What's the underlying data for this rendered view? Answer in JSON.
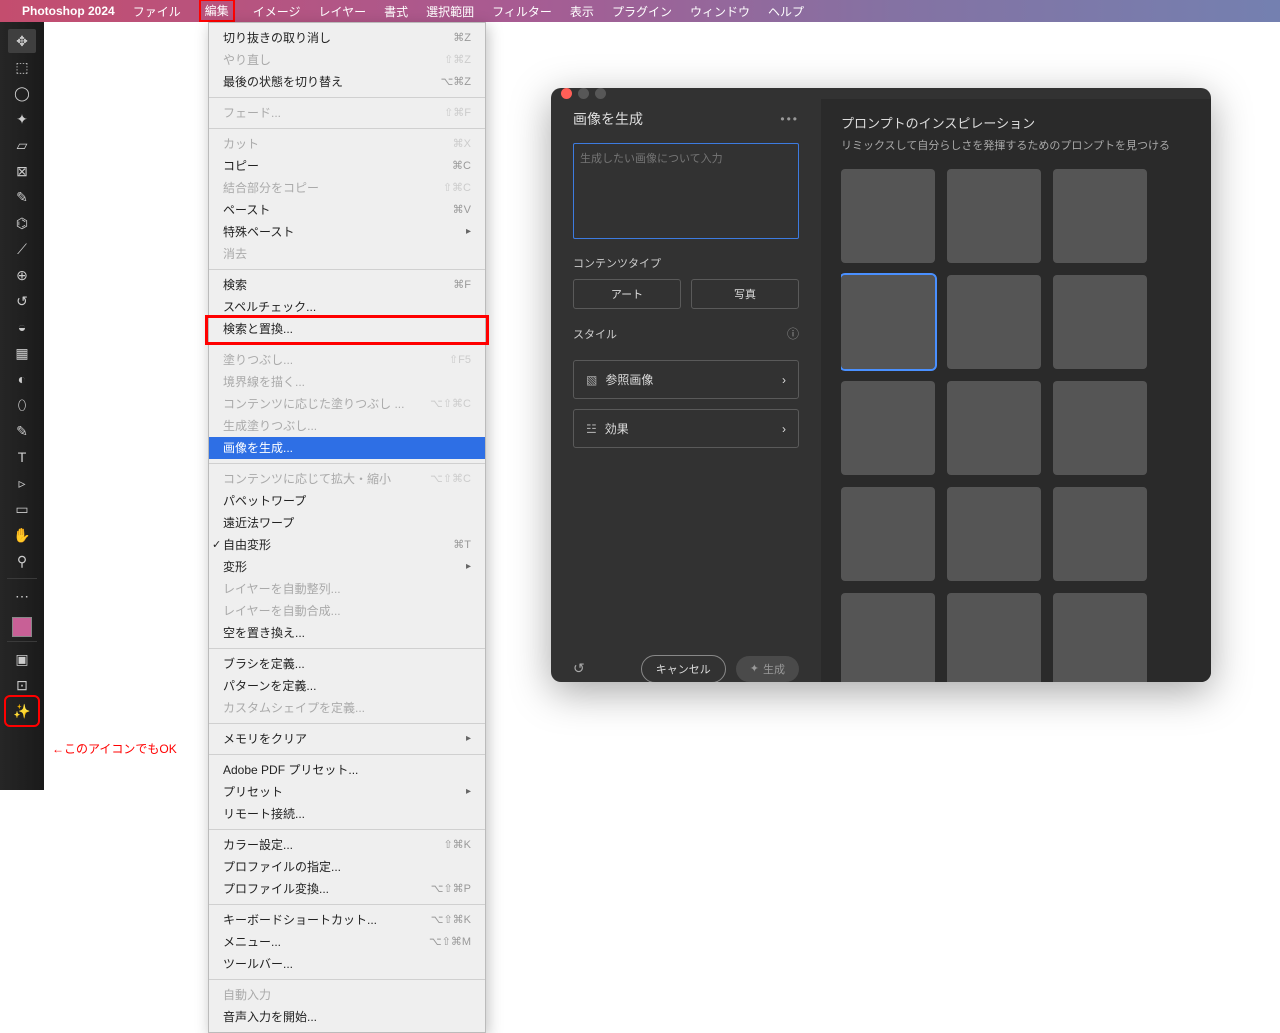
{
  "menubar": {
    "app": "Photoshop 2024",
    "items": [
      "ファイル",
      "編集",
      "イメージ",
      "レイヤー",
      "書式",
      "選択範囲",
      "フィルター",
      "表示",
      "プラグイン",
      "ウィンドウ",
      "ヘルプ"
    ]
  },
  "dropdown": {
    "groups": [
      [
        {
          "label": "切り抜きの取り消し",
          "sc": "⌘Z"
        },
        {
          "label": "やり直し",
          "sc": "⇧⌘Z",
          "disabled": true
        },
        {
          "label": "最後の状態を切り替え",
          "sc": "⌥⌘Z"
        }
      ],
      [
        {
          "label": "フェード...",
          "sc": "⇧⌘F",
          "disabled": true
        }
      ],
      [
        {
          "label": "カット",
          "sc": "⌘X",
          "disabled": true
        },
        {
          "label": "コピー",
          "sc": "⌘C"
        },
        {
          "label": "結合部分をコピー",
          "sc": "⇧⌘C",
          "disabled": true
        },
        {
          "label": "ペースト",
          "sc": "⌘V"
        },
        {
          "label": "特殊ペースト",
          "sub": true
        },
        {
          "label": "消去",
          "disabled": true
        }
      ],
      [
        {
          "label": "検索",
          "sc": "⌘F"
        },
        {
          "label": "スペルチェック..."
        },
        {
          "label": "検索と置換..."
        }
      ],
      [
        {
          "label": "塗りつぶし...",
          "sc": "⇧F5",
          "disabled": true
        },
        {
          "label": "境界線を描く...",
          "disabled": true
        },
        {
          "label": "コンテンツに応じた塗りつぶし ...",
          "sc": "⌥⇧⌘C",
          "disabled": true
        },
        {
          "label": "生成塗りつぶし...",
          "disabled": true
        },
        {
          "label": "画像を生成...",
          "highlight": true
        }
      ],
      [
        {
          "label": "コンテンツに応じて拡大・縮小",
          "sc": "⌥⇧⌘C",
          "disabled": true
        },
        {
          "label": "パペットワープ"
        },
        {
          "label": "遠近法ワープ"
        },
        {
          "label": "自由変形",
          "sc": "⌘T",
          "check": true
        },
        {
          "label": "変形",
          "sub": true
        },
        {
          "label": "レイヤーを自動整列...",
          "disabled": true
        },
        {
          "label": "レイヤーを自動合成...",
          "disabled": true
        },
        {
          "label": "空を置き換え..."
        }
      ],
      [
        {
          "label": "ブラシを定義..."
        },
        {
          "label": "パターンを定義..."
        },
        {
          "label": "カスタムシェイプを定義...",
          "disabled": true
        }
      ],
      [
        {
          "label": "メモリをクリア",
          "sub": true
        }
      ],
      [
        {
          "label": "Adobe PDF プリセット..."
        },
        {
          "label": "プリセット",
          "sub": true
        },
        {
          "label": "リモート接続..."
        }
      ],
      [
        {
          "label": "カラー設定...",
          "sc": "⇧⌘K"
        },
        {
          "label": "プロファイルの指定..."
        },
        {
          "label": "プロファイル変換...",
          "sc": "⌥⇧⌘P"
        }
      ],
      [
        {
          "label": "キーボードショートカット...",
          "sc": "⌥⇧⌘K"
        },
        {
          "label": "メニュー...",
          "sc": "⌥⇧⌘M"
        },
        {
          "label": "ツールバー..."
        }
      ],
      [
        {
          "label": "自動入力",
          "disabled": true
        },
        {
          "label": "音声入力を開始..."
        }
      ]
    ]
  },
  "dialog": {
    "title": "画像を生成",
    "prompt_placeholder": "生成したい画像について入力",
    "content_type_label": "コンテンツタイプ",
    "btn_art": "アート",
    "btn_photo": "写真",
    "style_label": "スタイル",
    "acc_ref": "参照画像",
    "acc_effect": "効果",
    "cancel": "キャンセル",
    "generate": "生成",
    "insp_title": "プロンプトのインスピレーション",
    "insp_sub": "リミックスして自分らしさを発揮するためのプロンプトを見つける"
  },
  "annotation": "←このアイコンでもOK",
  "tool_icons": [
    "⬚",
    "⬚",
    "▭",
    "✂",
    "▱",
    "▱",
    "✥",
    "◉",
    "✎",
    "⌬",
    "⟋",
    "◒",
    "⟋",
    "⟋",
    "◐",
    "⬯",
    "T",
    "▹",
    "▭",
    "✋",
    "⚲",
    "⇆"
  ]
}
